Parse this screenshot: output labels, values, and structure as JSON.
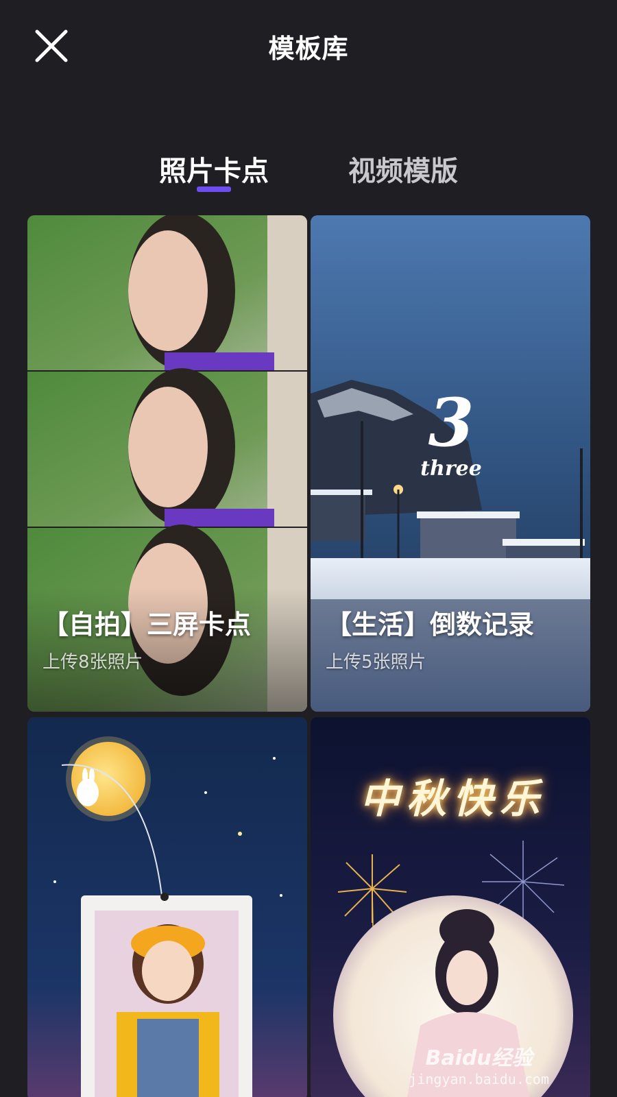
{
  "header": {
    "title": "模板库",
    "close_icon": "close-icon"
  },
  "tabs": [
    {
      "label": "照片卡点",
      "active": true
    },
    {
      "label": "视频模版",
      "active": false
    }
  ],
  "accent_color": "#6f4cf0",
  "templates": [
    {
      "name": "【自拍】三屏卡点",
      "subtitle": "上传8张照片"
    },
    {
      "name": "【生活】倒数记录",
      "subtitle": "上传5张照片",
      "overlay_number": "3",
      "overlay_word": "three"
    },
    {
      "name": "",
      "subtitle": ""
    },
    {
      "name": "",
      "subtitle": "",
      "overlay_text": "中秋快乐"
    }
  ],
  "watermark": {
    "brand": "Baidu经验",
    "url": "jingyan.baidu.com"
  }
}
